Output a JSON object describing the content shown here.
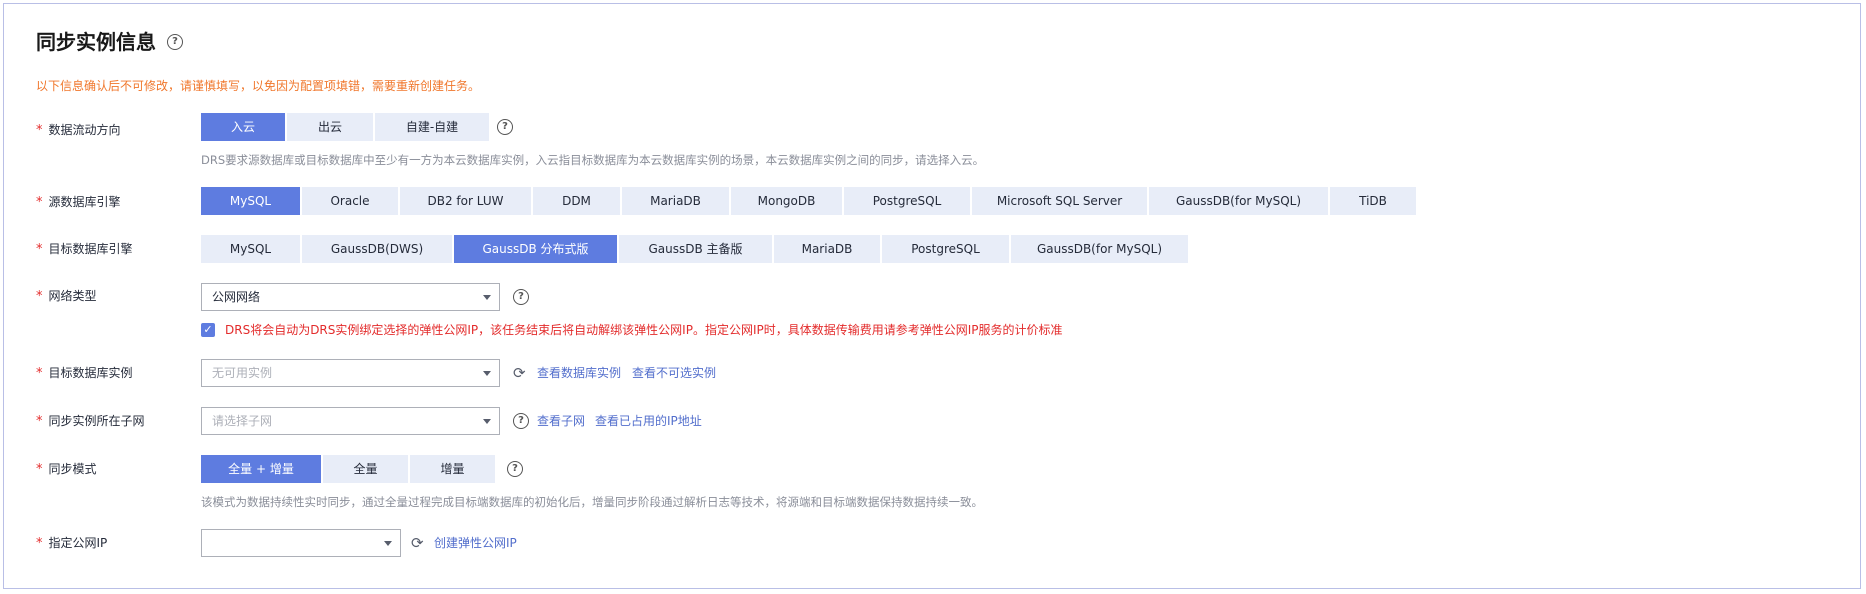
{
  "page": {
    "title": "同步实例信息",
    "warning": "以下信息确认后不可修改，请谨慎填写，以免因为配置项填错，需要重新创建任务。"
  },
  "direction": {
    "label": "数据流动方向",
    "options": [
      "入云",
      "出云",
      "自建-自建"
    ],
    "selected": "入云",
    "hint": "DRS要求源数据库或目标数据库中至少有一方为本云数据库实例，入云指目标数据库为本云数据库实例的场景，本云数据库实例之间的同步，请选择入云。"
  },
  "source_engine": {
    "label": "源数据库引擎",
    "options": [
      "MySQL",
      "Oracle",
      "DB2 for LUW",
      "DDM",
      "MariaDB",
      "MongoDB",
      "PostgreSQL",
      "Microsoft SQL Server",
      "GaussDB(for MySQL)",
      "TiDB"
    ],
    "selected": "MySQL"
  },
  "target_engine": {
    "label": "目标数据库引擎",
    "options": [
      "MySQL",
      "GaussDB(DWS)",
      "GaussDB 分布式版",
      "GaussDB 主备版",
      "MariaDB",
      "PostgreSQL",
      "GaussDB(for MySQL)"
    ],
    "selected": "GaussDB 分布式版"
  },
  "network": {
    "label": "网络类型",
    "value": "公网网络",
    "eip_notice": "DRS将会自动为DRS实例绑定选择的弹性公网IP，该任务结束后将自动解绑该弹性公网IP。指定公网IP时，具体数据传输费用请参考弹性公网IP服务的计价标准"
  },
  "target_instance": {
    "label": "目标数据库实例",
    "placeholder": "无可用实例",
    "link_view": "查看数据库实例",
    "link_unavailable": "查看不可选实例"
  },
  "subnet": {
    "label": "同步实例所在子网",
    "placeholder": "请选择子网",
    "link_view": "查看子网",
    "link_used_ip": "查看已占用的IP地址"
  },
  "sync_mode": {
    "label": "同步模式",
    "options": [
      "全量 + 增量",
      "全量",
      "增量"
    ],
    "selected": "全量 + 增量",
    "hint": "该模式为数据持续性实时同步，通过全量过程完成目标端数据库的初始化后，增量同步阶段通过解析日志等技术，将源端和目标端数据保持数据持续一致。"
  },
  "public_ip": {
    "label": "指定公网IP",
    "value": "",
    "link_create": "创建弹性公网IP"
  },
  "icons": {
    "help": "question-circle-icon",
    "refresh": "refresh-icon",
    "caret": "chevron-down-icon",
    "check": "checkbox-checked-icon"
  },
  "colors": {
    "primary": "#5e7ce0",
    "option_bg": "#e8edf8",
    "warning": "#f0772c",
    "required": "#e32b2b",
    "link": "#526ecc"
  }
}
